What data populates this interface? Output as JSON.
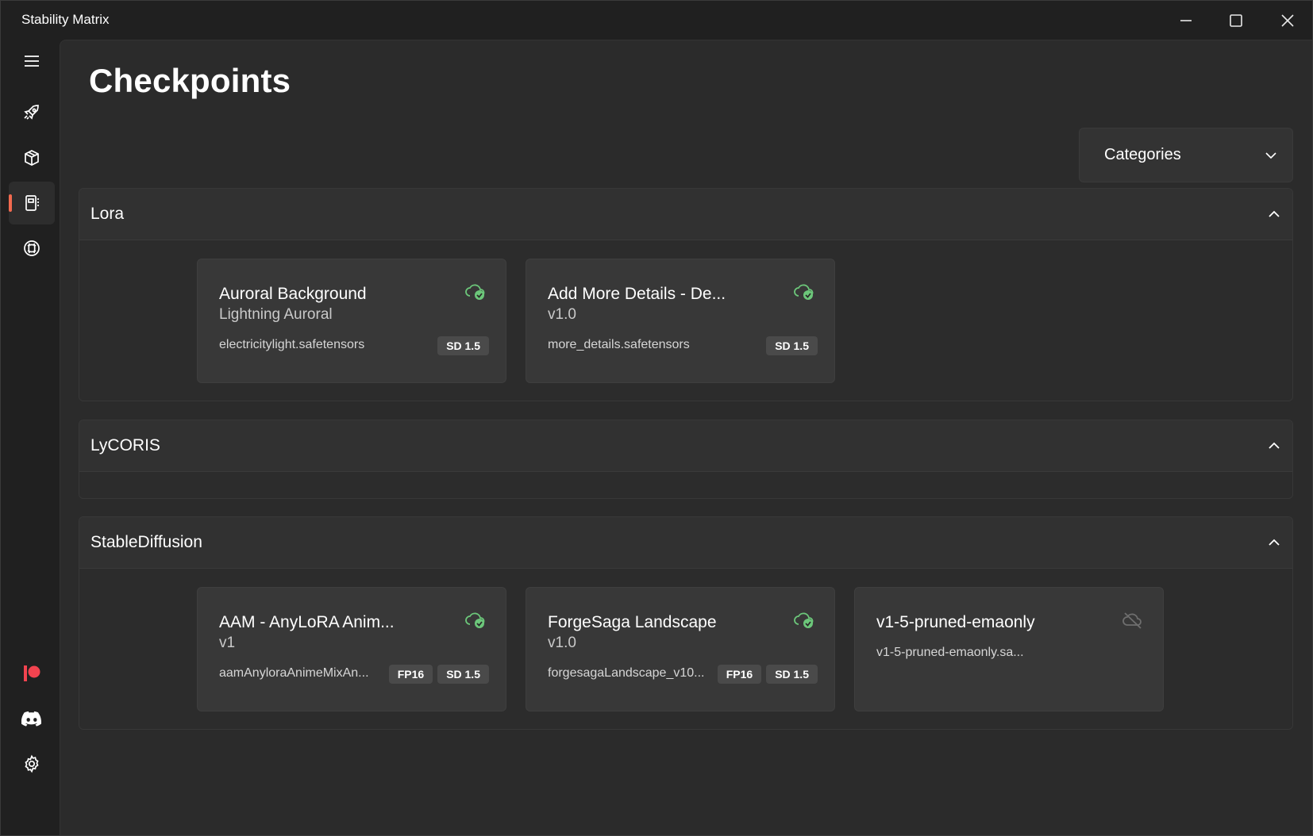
{
  "app": {
    "title": "Stability Matrix"
  },
  "window_controls": {
    "minimize_icon": "minimize-icon",
    "maximize_icon": "maximize-icon",
    "close_icon": "close-icon"
  },
  "sidebar": {
    "items": [
      {
        "name": "menu",
        "icon": "hamburger-icon"
      },
      {
        "name": "launch",
        "icon": "rocket-icon"
      },
      {
        "name": "packages",
        "icon": "box-icon"
      },
      {
        "name": "checkpoints",
        "icon": "notebook-icon",
        "active": true
      },
      {
        "name": "model-browser",
        "icon": "civitai-icon"
      }
    ],
    "bottom_items": [
      {
        "name": "patreon",
        "icon": "patreon-icon"
      },
      {
        "name": "discord",
        "icon": "discord-icon"
      },
      {
        "name": "settings",
        "icon": "gear-icon"
      }
    ],
    "accent_color": "#f26a4f"
  },
  "main": {
    "title": "Checkpoints",
    "categories_label": "Categories"
  },
  "groups": [
    {
      "title": "Lora",
      "cards": [
        {
          "title": "Auroral Background",
          "subtitle": "Lightning Auroral",
          "file": "electricitylight.safetensors",
          "badges": [
            "SD 1.5"
          ],
          "status": "connected"
        },
        {
          "title": "Add More Details - De...",
          "subtitle": "v1.0",
          "file": "more_details.safetensors",
          "badges": [
            "SD 1.5"
          ],
          "status": "connected"
        }
      ]
    },
    {
      "title": "LyCORIS",
      "cards": []
    },
    {
      "title": "StableDiffusion",
      "cards": [
        {
          "title": "AAM - AnyLoRA Anim...",
          "subtitle": "v1",
          "file": "aamAnyloraAnimeMixAn...",
          "badges": [
            "FP16",
            "SD 1.5"
          ],
          "status": "connected"
        },
        {
          "title": "ForgeSaga Landscape",
          "subtitle": "v1.0",
          "file": "forgesagaLandscape_v10...",
          "badges": [
            "FP16",
            "SD 1.5"
          ],
          "status": "connected"
        },
        {
          "title": "v1-5-pruned-emaonly",
          "subtitle": "",
          "file": "v1-5-pruned-emaonly.sa...",
          "badges": [],
          "status": "disconnected"
        }
      ]
    }
  ],
  "colors": {
    "connected": "#6cc77a",
    "disconnected": "#6e6e6e"
  }
}
